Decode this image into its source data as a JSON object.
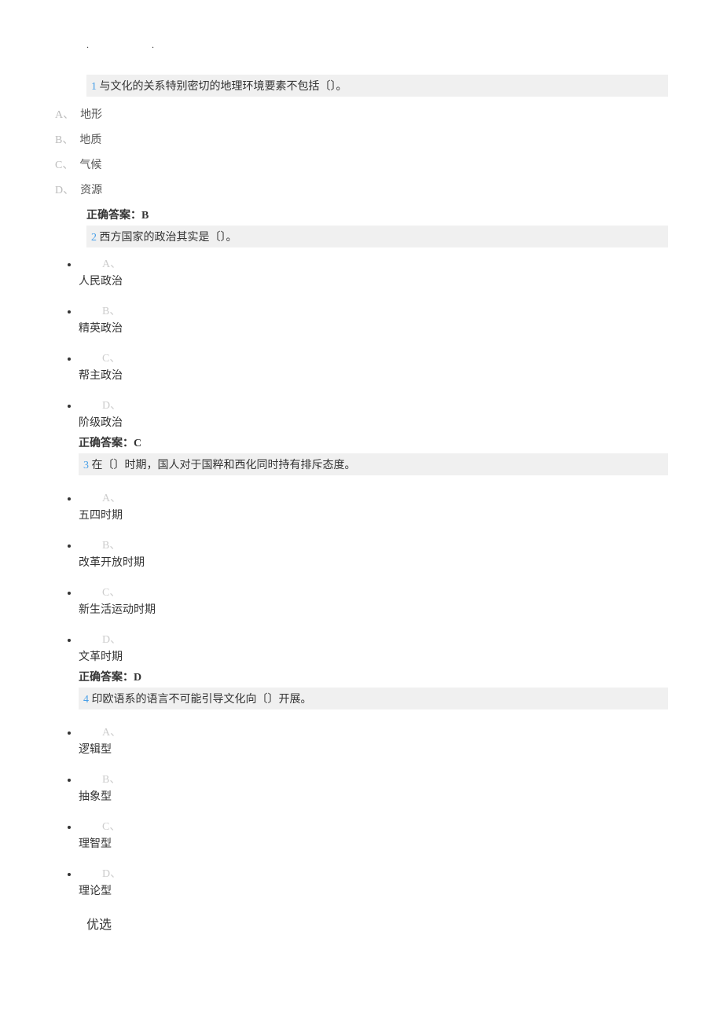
{
  "top_dots": "..",
  "q1": {
    "num": "1",
    "text": "与文化的关系特别密切的地理环境要素不包括〔〕。",
    "opts": {
      "a_lbl": "A、",
      "a_txt": "地形",
      "b_lbl": "B、",
      "b_txt": "地质",
      "c_lbl": "C、",
      "c_txt": "气候",
      "d_lbl": "D、",
      "d_txt": "资源"
    },
    "answer": "正确答案：B"
  },
  "q2": {
    "num": "2",
    "text": "西方国家的政治其实是〔〕。",
    "opts": {
      "a_lbl": "A、",
      "a_txt": "人民政治",
      "b_lbl": "B、",
      "b_txt": "精英政治",
      "c_lbl": "C、",
      "c_txt": "帮主政治",
      "d_lbl": "D、",
      "d_txt": "阶级政治"
    },
    "answer": "正确答案：C"
  },
  "q3": {
    "num": "3",
    "text": "在〔〕时期，国人对于国粹和西化同时持有排斥态度。",
    "opts": {
      "a_lbl": "A、",
      "a_txt": "五四时期",
      "b_lbl": "B、",
      "b_txt": "改革开放时期",
      "c_lbl": "C、",
      "c_txt": "新生活运动时期",
      "d_lbl": "D、",
      "d_txt": "文革时期"
    },
    "answer": "正确答案：D"
  },
  "q4": {
    "num": "4",
    "text": "印欧语系的语言不可能引导文化向〔〕开展。",
    "opts": {
      "a_lbl": "A、",
      "a_txt": "逻辑型",
      "b_lbl": "B、",
      "b_txt": "抽象型",
      "c_lbl": "C、",
      "c_txt": "理智型",
      "d_lbl": "D、",
      "d_txt": "理论型"
    }
  },
  "footer": "优选"
}
